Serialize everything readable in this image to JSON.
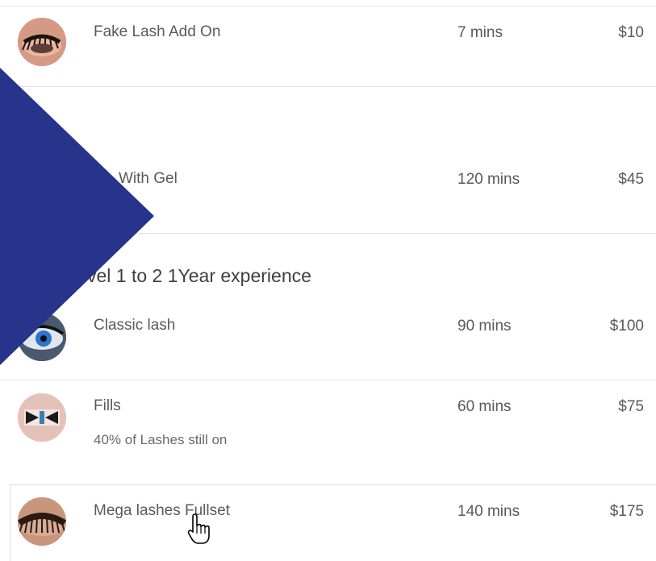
{
  "services": [
    {
      "name": "Fake Lash Add On",
      "note": "",
      "duration": "7 mins",
      "price": "$10",
      "image": "lash-closeup-photo"
    },
    {
      "name": "With Gel",
      "note": "",
      "duration": "120 mins",
      "price": "$45",
      "image": ""
    },
    {
      "name": "Classic lash",
      "note": "",
      "duration": "90 mins",
      "price": "$100",
      "image": "blue-eye-photo"
    },
    {
      "name": "Fills",
      "note": "40% of Lashes still on",
      "duration": "60 mins",
      "price": "$75",
      "image": "lash-fill-photo"
    },
    {
      "name": "Mega lashes Fullset",
      "note": "",
      "duration": "140 mins",
      "price": "$175",
      "image": "mega-lash-photo"
    }
  ],
  "section_heading": "vel 1 to 2 1Year experience",
  "decor": {
    "banner_color": "#26348b",
    "cursor_icon": "hand-pointer-icon"
  }
}
